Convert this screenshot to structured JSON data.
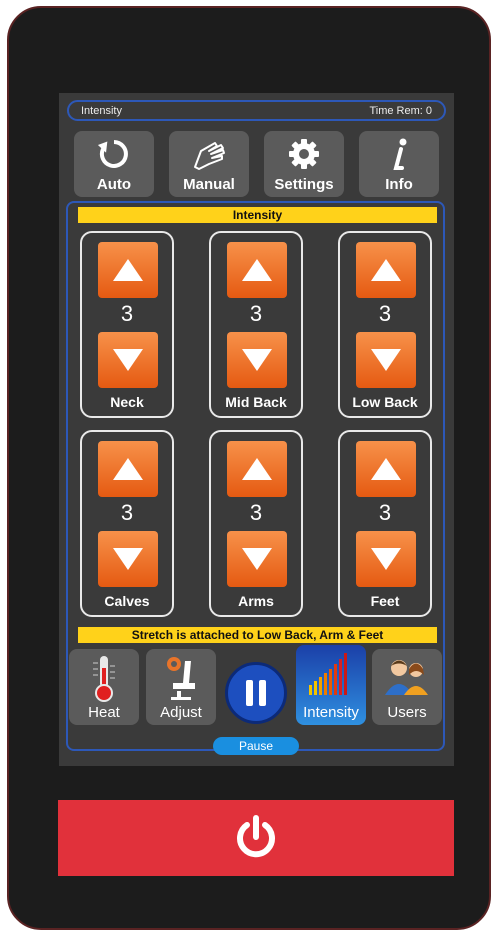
{
  "status": {
    "left": "Intensity",
    "right": "Time Rem: 0"
  },
  "nav": [
    {
      "label": "Auto",
      "icon": "refresh-icon"
    },
    {
      "label": "Manual",
      "icon": "hand-icon"
    },
    {
      "label": "Settings",
      "icon": "gear-icon"
    },
    {
      "label": "Info",
      "icon": "info-icon"
    }
  ],
  "panel": {
    "title": "Intensity",
    "zones": [
      {
        "name": "Neck",
        "value": "3"
      },
      {
        "name": "Mid Back",
        "value": "3"
      },
      {
        "name": "Low Back",
        "value": "3"
      },
      {
        "name": "Calves",
        "value": "3"
      },
      {
        "name": "Arms",
        "value": "3"
      },
      {
        "name": "Feet",
        "value": "3"
      }
    ],
    "footer_note": "Stretch is attached to Low Back, Arm & Feet"
  },
  "bottom": {
    "heat": "Heat",
    "adjust": "Adjust",
    "intensity": "Intensity",
    "users": "Users",
    "pause": "Pause"
  },
  "colors": {
    "accent_orange": "#f26d21",
    "panel_border": "#2d58b8",
    "banner_yellow": "#ffd21a",
    "power_red": "#e1313b"
  }
}
